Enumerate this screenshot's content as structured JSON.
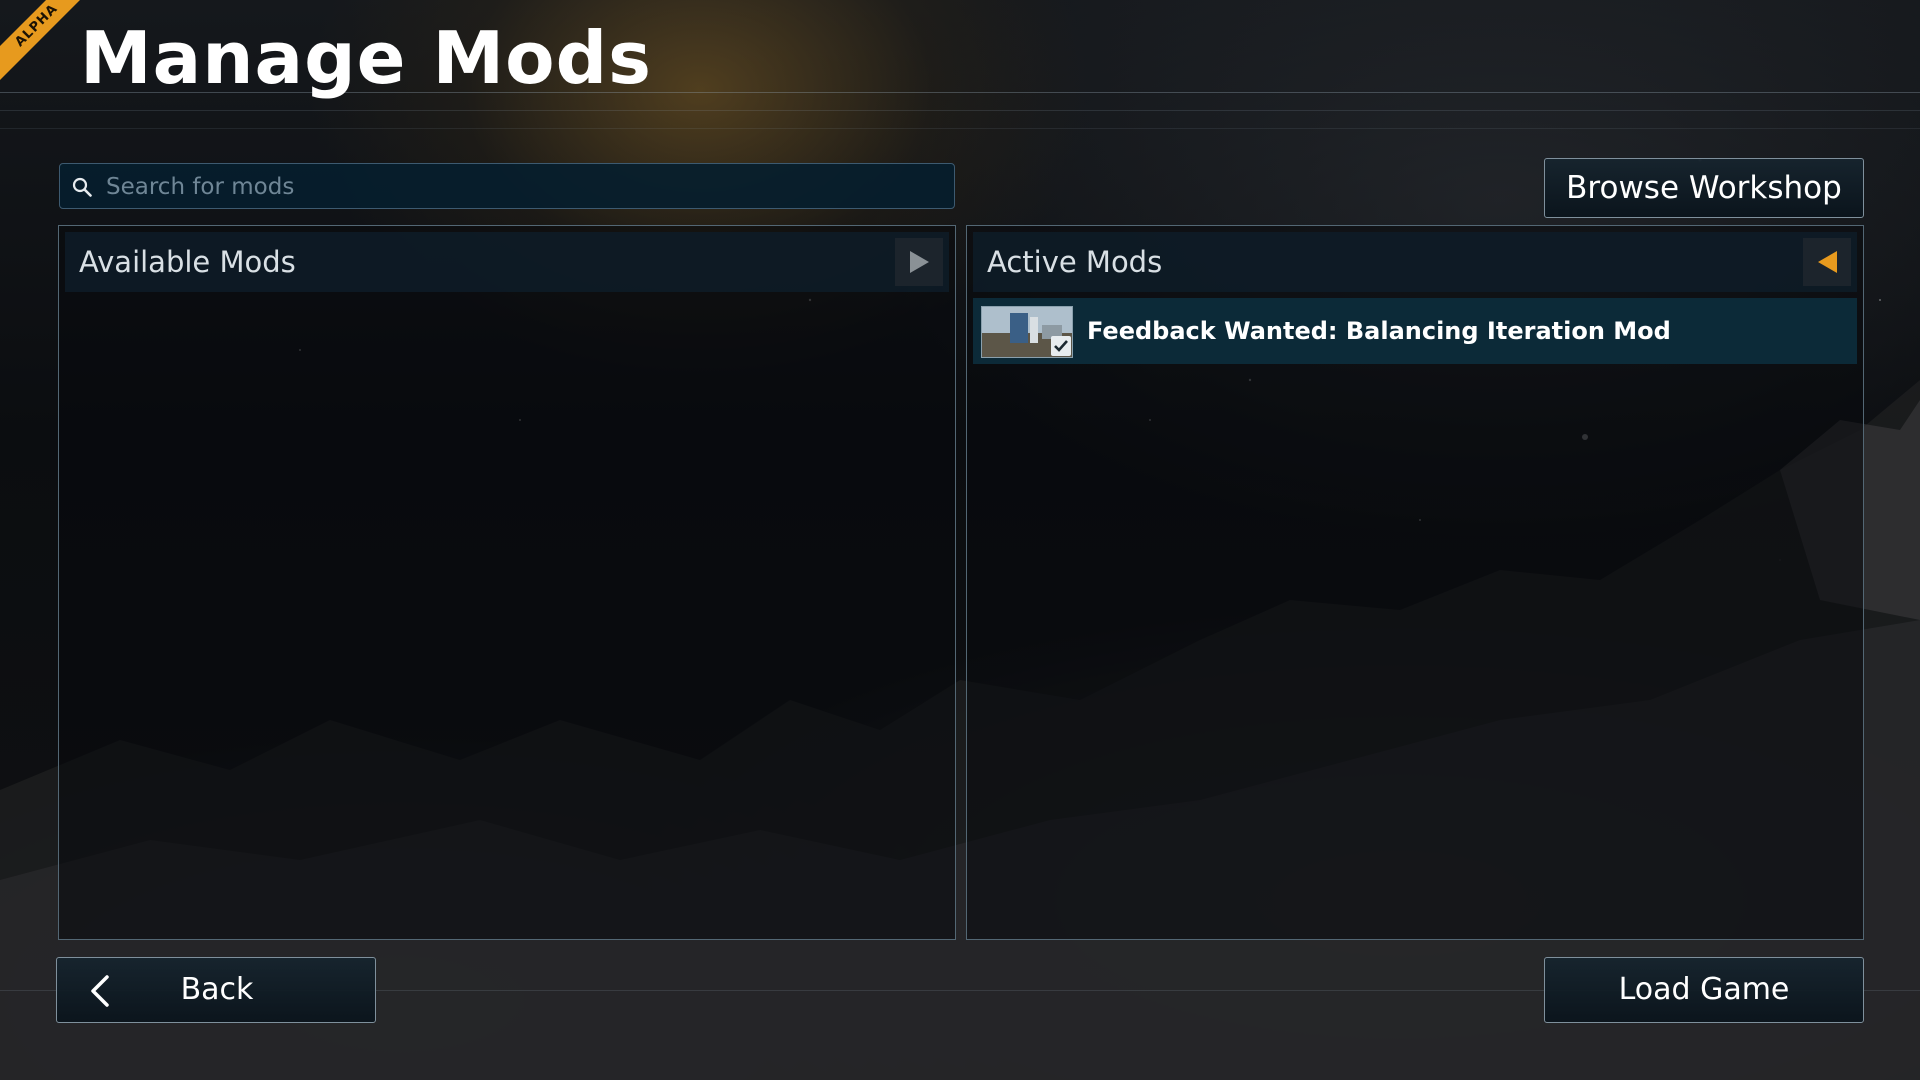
{
  "alpha_badge": "ALPHA",
  "page_title": "Manage Mods",
  "search": {
    "placeholder": "Search for mods",
    "value": ""
  },
  "buttons": {
    "browse_workshop": "Browse Workshop",
    "back": "Back",
    "load_game": "Load Game"
  },
  "available_mods": {
    "title": "Available Mods",
    "items": []
  },
  "active_mods": {
    "title": "Active Mods",
    "items": [
      {
        "name": "Feedback Wanted: Balancing Iteration Mod",
        "checked": true
      }
    ]
  },
  "icons": {
    "search": "search-icon",
    "move_right": "play-right-icon",
    "move_left": "play-left-icon",
    "back": "chevron-left-icon",
    "check": "check-icon"
  },
  "colors": {
    "accent": "#e79a1e",
    "panel_border": "#536774",
    "row_selected": "#0c2a38"
  }
}
